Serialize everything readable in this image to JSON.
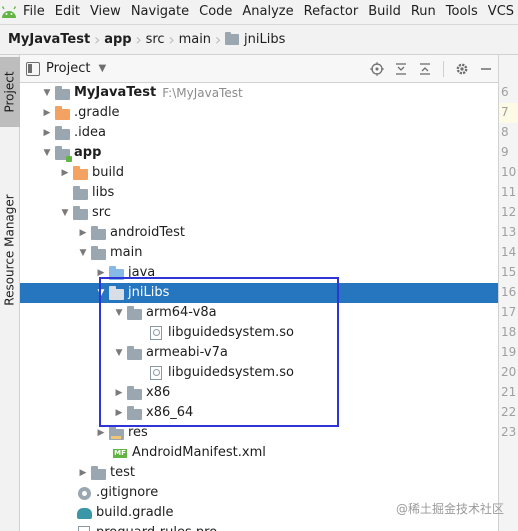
{
  "menubar": {
    "items": [
      "File",
      "Edit",
      "View",
      "Navigate",
      "Code",
      "Analyze",
      "Refactor",
      "Build",
      "Run",
      "Tools",
      "VCS"
    ]
  },
  "breadcrumb": {
    "items": [
      "MyJavaTest",
      "app",
      "src",
      "main",
      "jniLibs"
    ]
  },
  "left_strip": {
    "project_tab": "Project",
    "resource_tab": "Resource Manager"
  },
  "panel": {
    "title": "Project"
  },
  "gutter": {
    "numbers": [
      "6",
      "7",
      "8",
      "9",
      "10",
      "11",
      "12",
      "13",
      "14",
      "15",
      "16",
      "17",
      "18",
      "19",
      "20",
      "21",
      "22",
      "23"
    ]
  },
  "tree": {
    "rows": [
      {
        "label": "MyJavaTest",
        "hint": "F:\\MyJavaTest",
        "bold": true
      },
      {
        "label": ".gradle"
      },
      {
        "label": ".idea"
      },
      {
        "label": "app",
        "bold": true
      },
      {
        "label": "build"
      },
      {
        "label": "libs"
      },
      {
        "label": "src"
      },
      {
        "label": "androidTest"
      },
      {
        "label": "main"
      },
      {
        "label": "java"
      },
      {
        "label": "jniLibs",
        "selected": true
      },
      {
        "label": "arm64-v8a"
      },
      {
        "label": "libguidedsystem.so"
      },
      {
        "label": "armeabi-v7a"
      },
      {
        "label": "libguidedsystem.so"
      },
      {
        "label": "x86"
      },
      {
        "label": "x86_64"
      },
      {
        "label": "res"
      },
      {
        "label": "AndroidManifest.xml"
      },
      {
        "label": "test"
      },
      {
        "label": ".gitignore"
      },
      {
        "label": "build.gradle"
      },
      {
        "label": "proguard-rules.pro"
      }
    ]
  },
  "watermark": "@稀土掘金技术社区",
  "colors": {
    "selection": "#2675bf",
    "annotation_box": "#2f34d6",
    "folder_orange": "#f4a261",
    "folder_blue": "#87b9e6",
    "folder_gray": "#9aa7b0"
  }
}
